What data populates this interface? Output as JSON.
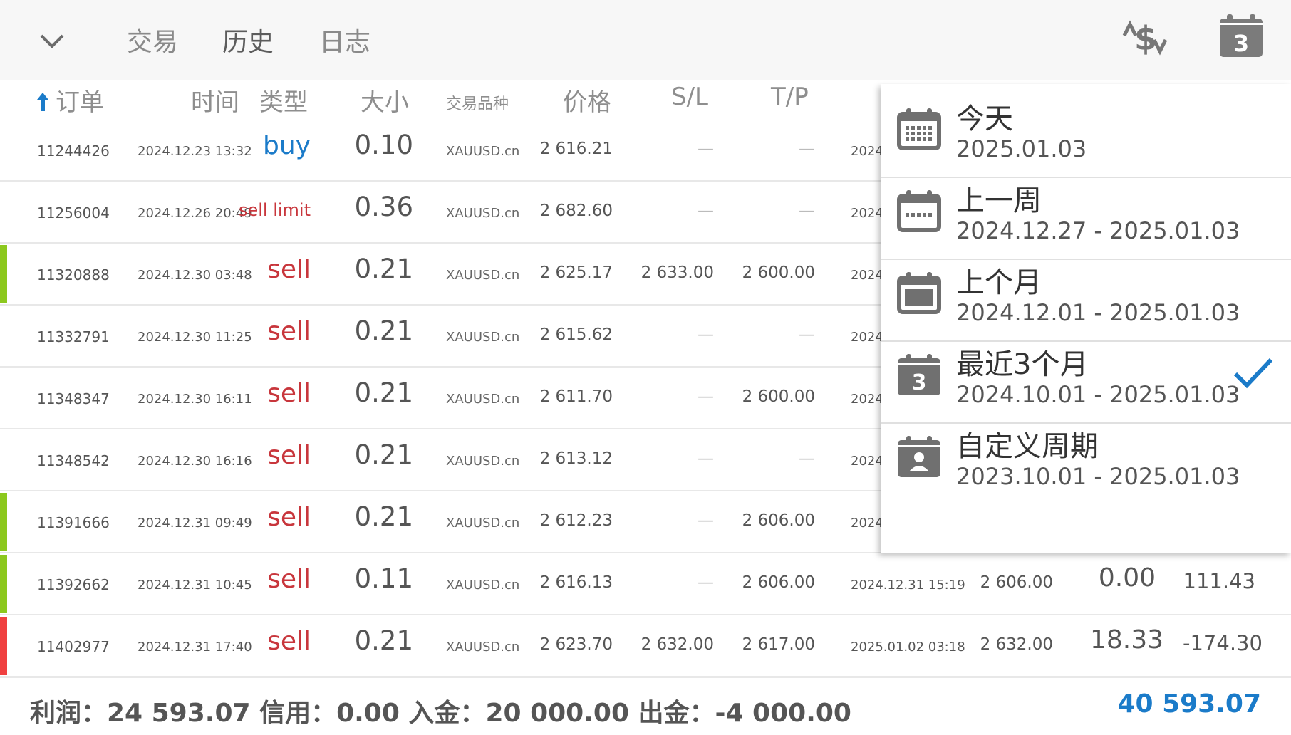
{
  "tabs": [
    "交易",
    "历史",
    "日志"
  ],
  "active_tab_index": 1,
  "calendar_badge": "3",
  "columns": {
    "order": "订单",
    "time": "时间",
    "type": "类型",
    "size": "大小",
    "symbol": "交易品种",
    "price": "价格",
    "sl": "S/L",
    "tp": "T/P"
  },
  "rows": [
    {
      "order": "11244426",
      "time": "2024.12.23 13:32",
      "type": "buy",
      "size": "0.10",
      "symbol": "XAUUSD.cn",
      "price": "2 616.21",
      "sl": "—",
      "tp": "—",
      "close_time": "2024.",
      "close_price": "",
      "swap": "",
      "profit": "",
      "marker": ""
    },
    {
      "order": "11256004",
      "time": "2024.12.26 20:49",
      "type": "sell limit",
      "size": "0.36",
      "symbol": "XAUUSD.cn",
      "price": "2 682.60",
      "sl": "—",
      "tp": "—",
      "close_time": "2024.",
      "close_price": "",
      "swap": "",
      "profit": "",
      "marker": ""
    },
    {
      "order": "11320888",
      "time": "2024.12.30 03:48",
      "type": "sell",
      "size": "0.21",
      "symbol": "XAUUSD.cn",
      "price": "2 625.17",
      "sl": "2 633.00",
      "tp": "2 600.00",
      "close_time": "2024.",
      "close_price": "",
      "swap": "",
      "profit": "",
      "marker": "#8cc81e"
    },
    {
      "order": "11332791",
      "time": "2024.12.30 11:25",
      "type": "sell",
      "size": "0.21",
      "symbol": "XAUUSD.cn",
      "price": "2 615.62",
      "sl": "—",
      "tp": "—",
      "close_time": "2024.",
      "close_price": "",
      "swap": "",
      "profit": "",
      "marker": ""
    },
    {
      "order": "11348347",
      "time": "2024.12.30 16:11",
      "type": "sell",
      "size": "0.21",
      "symbol": "XAUUSD.cn",
      "price": "2 611.70",
      "sl": "—",
      "tp": "2 600.00",
      "close_time": "2024.",
      "close_price": "",
      "swap": "",
      "profit": "",
      "marker": ""
    },
    {
      "order": "11348542",
      "time": "2024.12.30 16:16",
      "type": "sell",
      "size": "0.21",
      "symbol": "XAUUSD.cn",
      "price": "2 613.12",
      "sl": "—",
      "tp": "—",
      "close_time": "2024.",
      "close_price": "",
      "swap": "",
      "profit": "",
      "marker": ""
    },
    {
      "order": "11391666",
      "time": "2024.12.31 09:49",
      "type": "sell",
      "size": "0.21",
      "symbol": "XAUUSD.cn",
      "price": "2 612.23",
      "sl": "—",
      "tp": "2 606.00",
      "close_time": "2024.",
      "close_price": "",
      "swap": "",
      "profit": "",
      "marker": "#8cc81e"
    },
    {
      "order": "11392662",
      "time": "2024.12.31 10:45",
      "type": "sell",
      "size": "0.11",
      "symbol": "XAUUSD.cn",
      "price": "2 616.13",
      "sl": "—",
      "tp": "2 606.00",
      "close_time": "2024.12.31 15:19",
      "close_price": "2 606.00",
      "swap": "0.00",
      "profit": "111.43",
      "marker": "#8cc81e"
    },
    {
      "order": "11402977",
      "time": "2024.12.31 17:40",
      "type": "sell",
      "size": "0.21",
      "symbol": "XAUUSD.cn",
      "price": "2 623.70",
      "sl": "2 632.00",
      "tp": "2 617.00",
      "close_time": "2025.01.02 03:18",
      "close_price": "2 632.00",
      "swap": "18.33",
      "profit": "-174.30",
      "marker": "#f04040"
    }
  ],
  "footer": {
    "summary": "利润：24 593.07   信用：0.00   入金：20 000.00   出金：-4 000.00",
    "total": "40 593.07"
  },
  "period_menu": [
    {
      "label": "今天",
      "range": "2025.01.03",
      "icon": "calendar-grid-icon",
      "selected": false
    },
    {
      "label": "上一周",
      "range": "2024.12.27 - 2025.01.03",
      "icon": "calendar-week-icon",
      "selected": false
    },
    {
      "label": "上个月",
      "range": "2024.12.01 - 2025.01.03",
      "icon": "calendar-month-icon",
      "selected": false
    },
    {
      "label": "最近3个月",
      "range": "2024.10.01 - 2025.01.03",
      "icon": "calendar-3-icon",
      "selected": true
    },
    {
      "label": "自定义周期",
      "range": "2023.10.01 - 2025.01.03",
      "icon": "calendar-person-icon",
      "selected": false
    }
  ],
  "colors": {
    "accent": "#1b7bc9",
    "sell": "#c8363c",
    "buy": "#1b7bc9",
    "win": "#8cc81e",
    "loss": "#f04040"
  }
}
